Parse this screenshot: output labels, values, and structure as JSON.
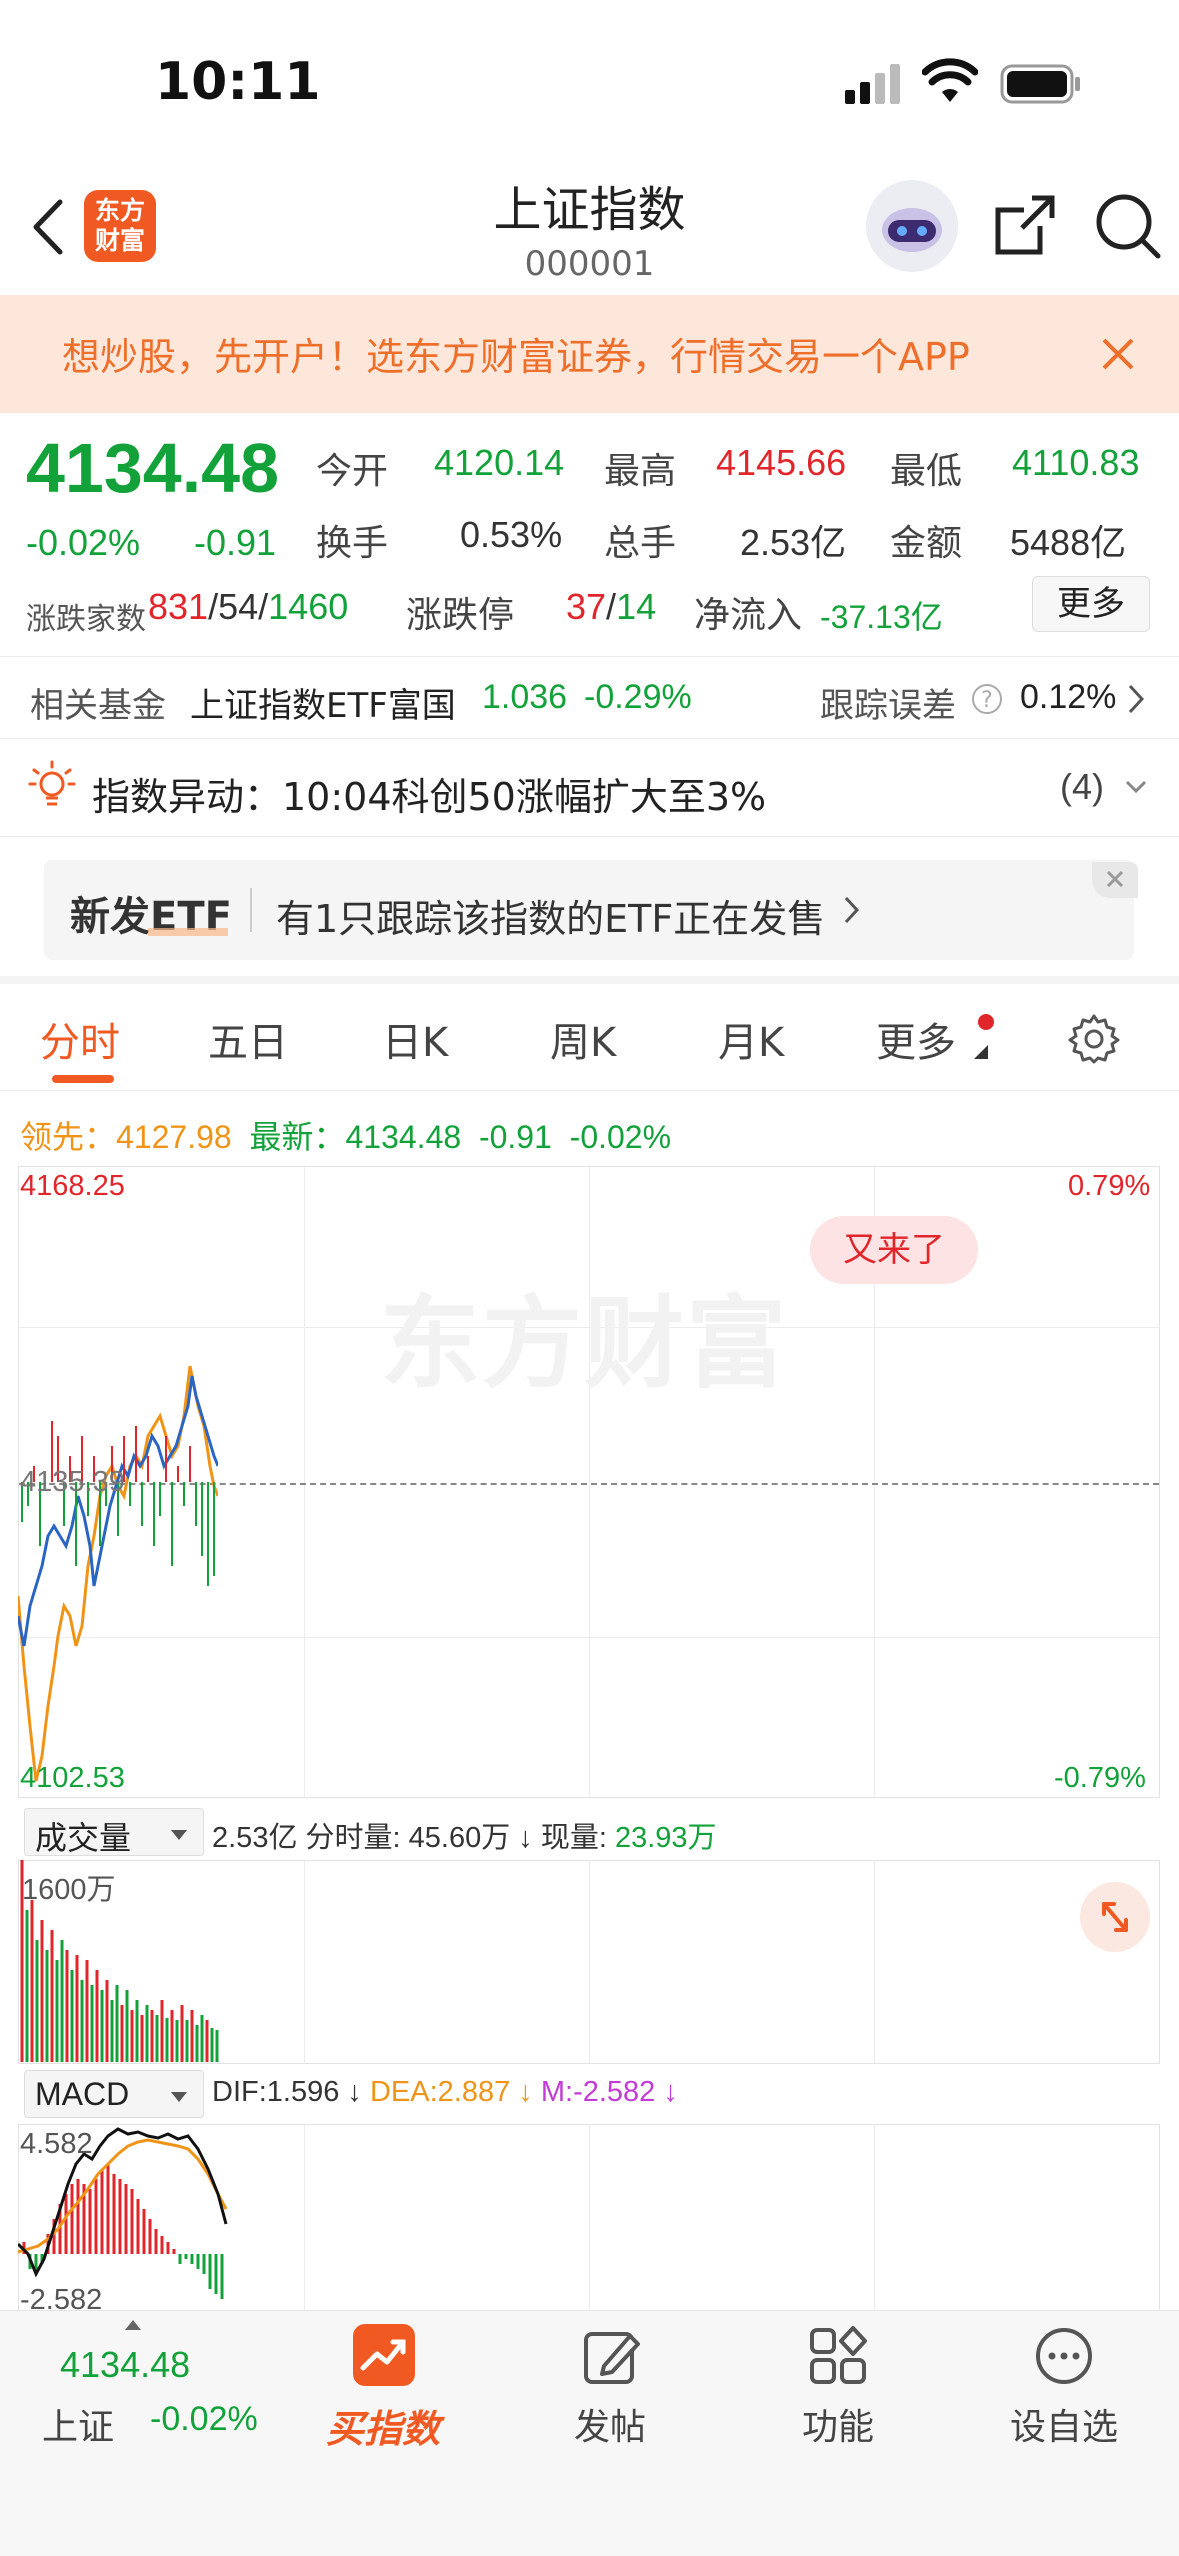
{
  "status": {
    "time": "10:11"
  },
  "nav": {
    "title": "上证指数",
    "code": "000001",
    "logo_text": "东方财富"
  },
  "banner": {
    "text": "想炒股，先开户！选东方财富证券，行情交易一个APP"
  },
  "quote": {
    "price": "4134.48",
    "change_pct": "-0.02%",
    "change": "-0.91",
    "open_label": "今开",
    "open": "4120.14",
    "high_label": "最高",
    "high": "4145.66",
    "low_label": "最低",
    "low": "4110.83",
    "turnover_label": "换手",
    "turnover": "0.53%",
    "volume_label": "总手",
    "volume": "2.53亿",
    "amount_label": "金额",
    "amount": "5488亿",
    "breadth_label": "涨跌家数",
    "up": "831",
    "flat": "54",
    "down": "1460",
    "limit_label": "涨跌停",
    "limit_up": "37",
    "limit_down": "14",
    "netflow_label": "净流入",
    "netflow": "-37.13亿",
    "more_label": "更多"
  },
  "fund": {
    "label": "相关基金",
    "name": "上证指数ETF富国",
    "price": "1.036",
    "change": "-0.29%",
    "track_label": "跟踪误差",
    "track_value": "0.12%"
  },
  "alert": {
    "text": "指数异动：10:04科创50涨幅扩大至3%",
    "count": "(4)"
  },
  "etf_card": {
    "badge": "新发ETF",
    "text": "有1只跟踪该指数的ETF正在发售"
  },
  "tabs": [
    "分时",
    "五日",
    "日K",
    "周K",
    "月K",
    "更多"
  ],
  "legend": {
    "lead_label": "领先：",
    "lead_value": "4127.98",
    "latest_label": "最新：",
    "latest_value": "4134.48",
    "latest_change": "-0.91",
    "latest_pct": "-0.02%"
  },
  "main_chart": {
    "y_top": "4168.25",
    "y_bottom": "4102.53",
    "pct_top": "0.79%",
    "pct_bottom": "-0.79%",
    "mid_label": "4135.39",
    "watermark": "东方财富",
    "bubble": "又来了"
  },
  "volume_panel": {
    "selector": "成交量",
    "total": "2.53亿",
    "minute_label": "分时量:",
    "minute_value": "45.60万",
    "now_label": "现量:",
    "now_value": "23.93万",
    "y_top": "1600万"
  },
  "macd_panel": {
    "selector": "MACD",
    "dif": "DIF:1.596",
    "dea": "DEA:2.887",
    "m": "M:-2.582",
    "y_top": "4.582",
    "y_bottom": "-2.582"
  },
  "bottom_bar": {
    "index_price": "4134.48",
    "index_name": "上证",
    "index_pct": "-0.02%",
    "items": [
      "买指数",
      "发帖",
      "功能",
      "设自选"
    ]
  },
  "colors": {
    "up": "#e0262a",
    "down": "#13a23a",
    "accent": "#f05a22",
    "lead_line": "#f09418",
    "price_line": "#2b65c4"
  }
}
